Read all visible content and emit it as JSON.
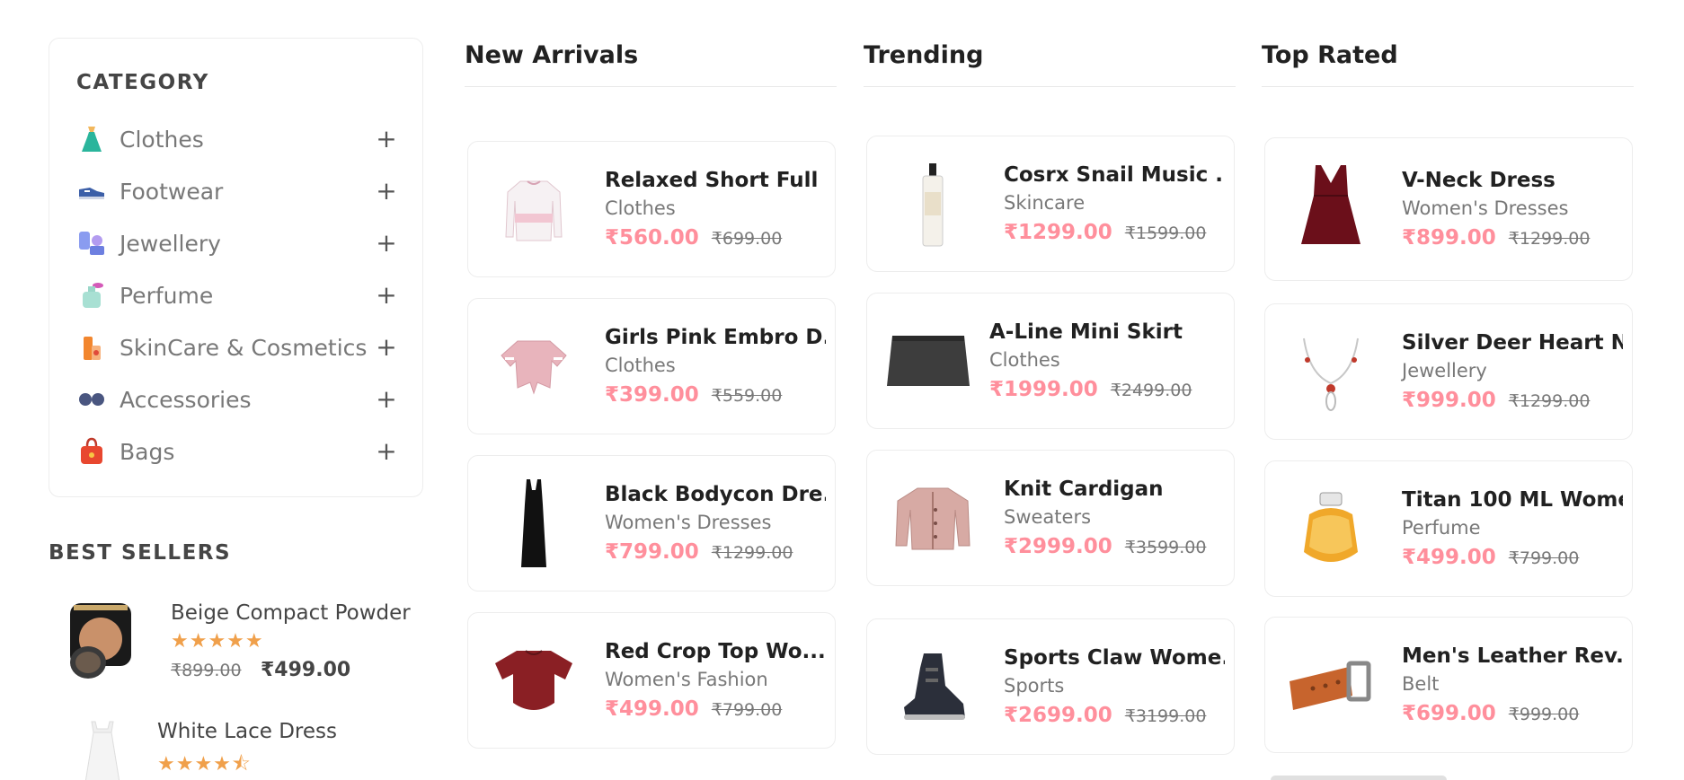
{
  "category": {
    "title": "CATEGORY",
    "items": [
      {
        "label": "Clothes",
        "icon": "dress-icon"
      },
      {
        "label": "Footwear",
        "icon": "shoe-icon"
      },
      {
        "label": "Jewellery",
        "icon": "jewellery-icon"
      },
      {
        "label": "Perfume",
        "icon": "perfume-icon"
      },
      {
        "label": "SkinCare & Cosmetics",
        "icon": "cosmetics-icon"
      },
      {
        "label": "Accessories",
        "icon": "glasses-icon"
      },
      {
        "label": "Bags",
        "icon": "bag-icon"
      }
    ],
    "expand_symbol": "+"
  },
  "best_sellers": {
    "title": "BEST SELLERS",
    "items": [
      {
        "name": "Beige Compact Powder",
        "stars": "★★★★★",
        "old_price": "₹899.00",
        "price": "₹499.00"
      },
      {
        "name": "White Lace Dress",
        "stars": "★★★★⯪",
        "old_price": "",
        "price": ""
      }
    ]
  },
  "columns": [
    {
      "title": "New Arrivals",
      "products": [
        {
          "name": "Relaxed Short Full ...",
          "category": "Clothes",
          "price": "₹560.00",
          "old_price": "₹699.00"
        },
        {
          "name": "Girls Pink Embro D...",
          "category": "Clothes",
          "price": "₹399.00",
          "old_price": "₹559.00"
        },
        {
          "name": "Black Bodycon Dre...",
          "category": "Women's Dresses",
          "price": "₹799.00",
          "old_price": "₹1299.00"
        },
        {
          "name": "Red Crop Top Wo...",
          "category": "Women's Fashion",
          "price": "₹499.00",
          "old_price": "₹799.00"
        }
      ]
    },
    {
      "title": "Trending",
      "products": [
        {
          "name": "Cosrx Snail Music ...",
          "category": "Skincare",
          "price": "₹1299.00",
          "old_price": "₹1599.00"
        },
        {
          "name": "A-Line Mini Skirt",
          "category": "Clothes",
          "price": "₹1999.00",
          "old_price": "₹2499.00"
        },
        {
          "name": "Knit Cardigan",
          "category": "Sweaters",
          "price": "₹2999.00",
          "old_price": "₹3599.00"
        },
        {
          "name": "Sports Claw Wome...",
          "category": "Sports",
          "price": "₹2699.00",
          "old_price": "₹3199.00"
        }
      ]
    },
    {
      "title": "Top Rated",
      "products": [
        {
          "name": "V-Neck Dress",
          "category": "Women's Dresses",
          "price": "₹899.00",
          "old_price": "₹1299.00"
        },
        {
          "name": "Silver Deer Heart N...",
          "category": "Jewellery",
          "price": "₹999.00",
          "old_price": "₹1299.00"
        },
        {
          "name": "Titan 100 ML Wome...",
          "category": "Perfume",
          "price": "₹499.00",
          "old_price": "₹799.00"
        },
        {
          "name": "Men's Leather Rev...",
          "category": "Belt",
          "price": "₹699.00",
          "old_price": "₹999.00"
        }
      ]
    }
  ],
  "colors": {
    "accent": "#ff8f9c",
    "star": "#f0a04b",
    "muted": "#787878"
  }
}
